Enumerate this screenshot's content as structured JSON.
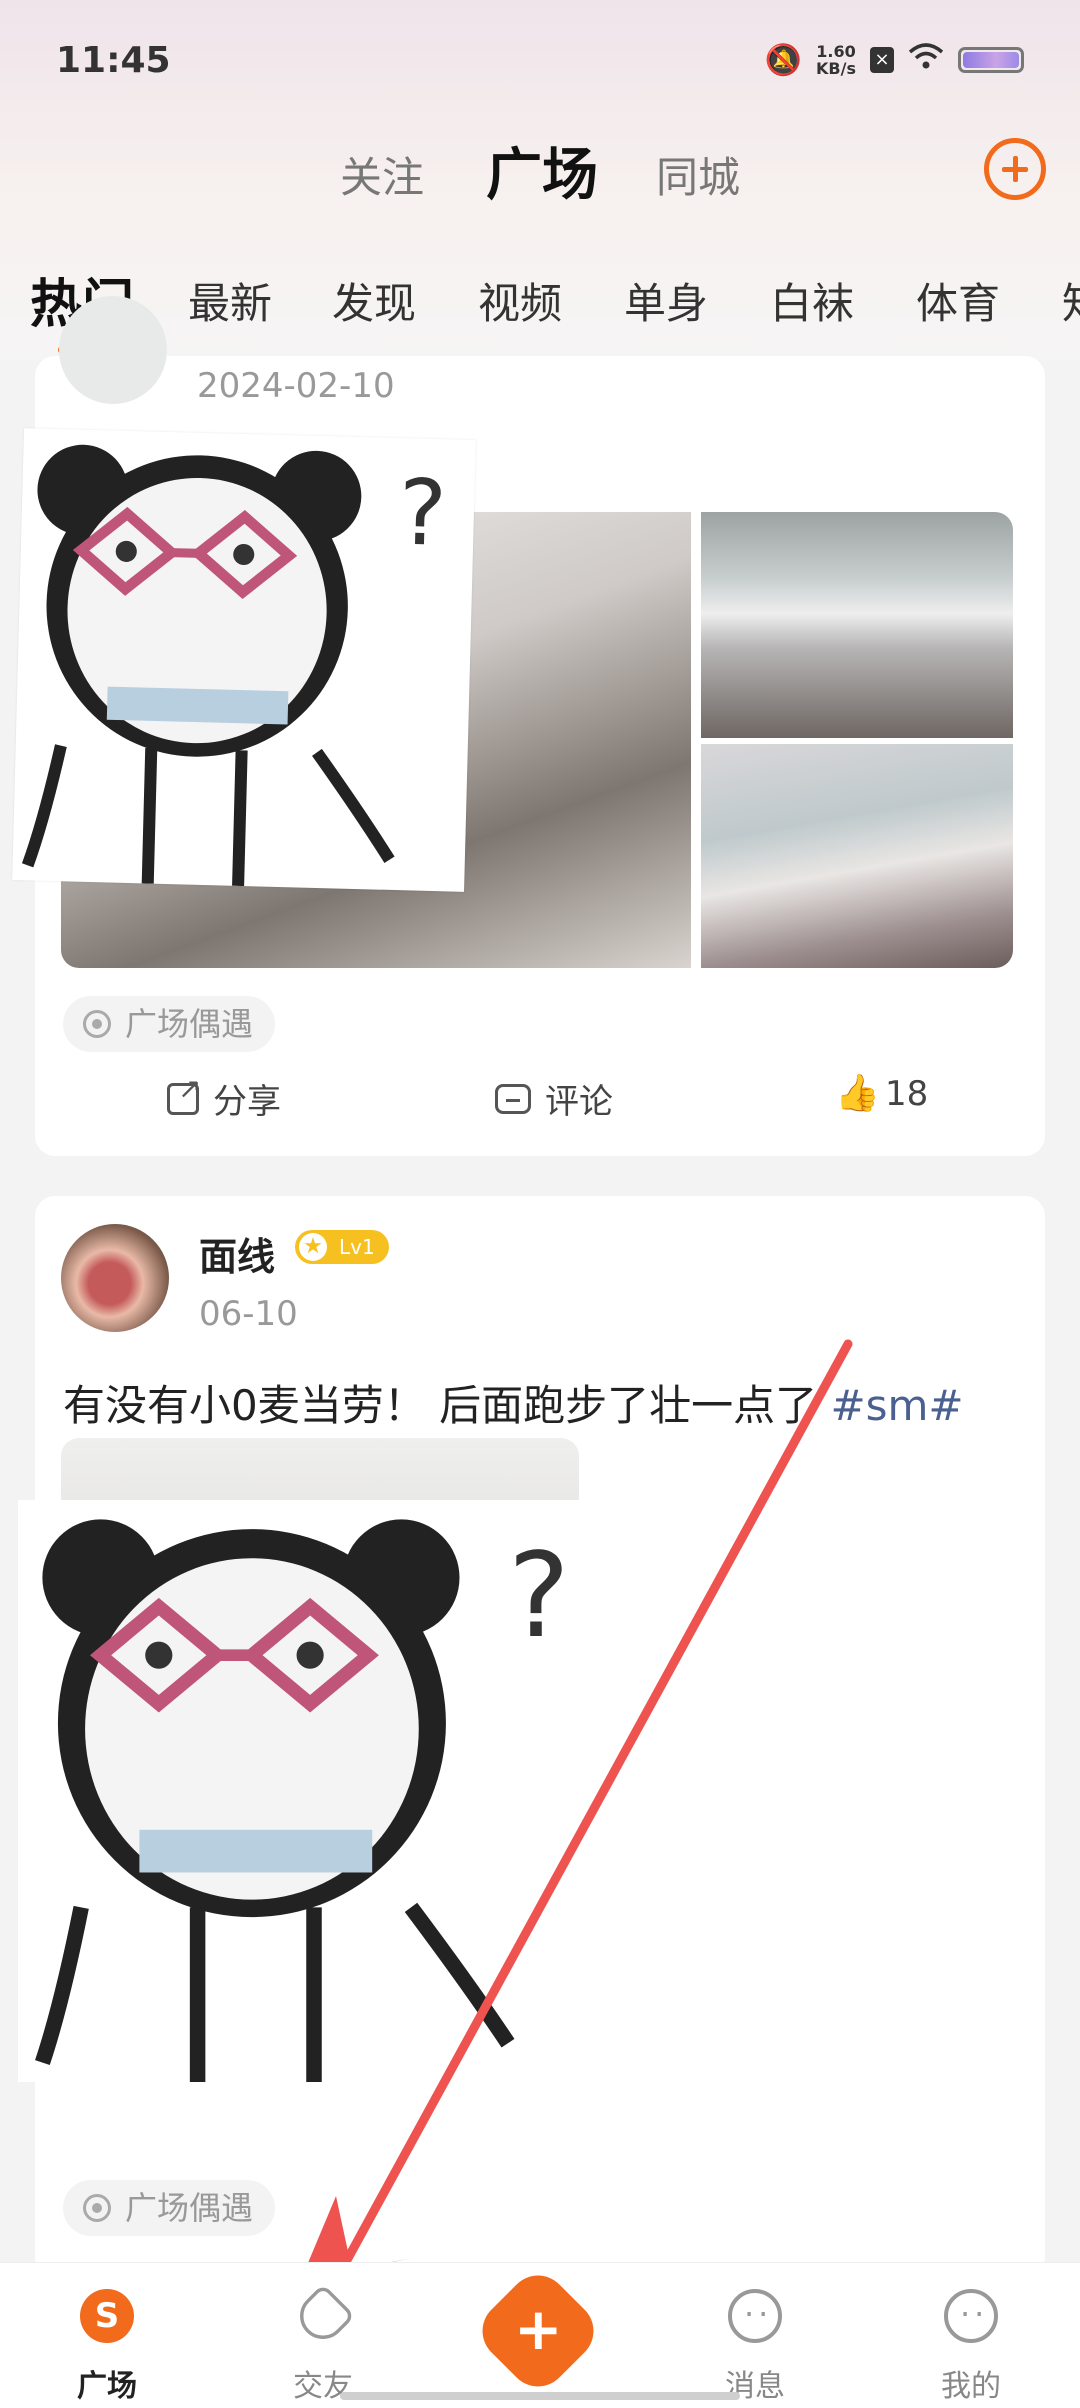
{
  "status_bar": {
    "time": "11:45",
    "net_speed_value": "1.60",
    "net_speed_unit": "KB/s"
  },
  "top_tabs": {
    "follow": "关注",
    "square": "广场",
    "city": "同城"
  },
  "category_tabs": [
    "热门",
    "最新",
    "发现",
    "视频",
    "单身",
    "白袜",
    "体育",
    "知"
  ],
  "posts": [
    {
      "date": "2024-02-10",
      "location_chip": "广场偶遇",
      "share_label": "分享",
      "comment_label": "评论",
      "likes": "18"
    },
    {
      "username": "面线",
      "level": "Lv1",
      "date": "06-10",
      "text": "有没有小0麦当劳！ 后面跑步了壮一点了 ",
      "hashtag": "#sm#",
      "location_chip": "广场偶遇"
    }
  ],
  "bottom_nav": {
    "home": "广场",
    "friends": "交友",
    "messages": "消息",
    "me": "我的"
  },
  "colors": {
    "accent": "#f26a1b",
    "hashtag": "#4a6090",
    "arrow": "#ef5350"
  }
}
